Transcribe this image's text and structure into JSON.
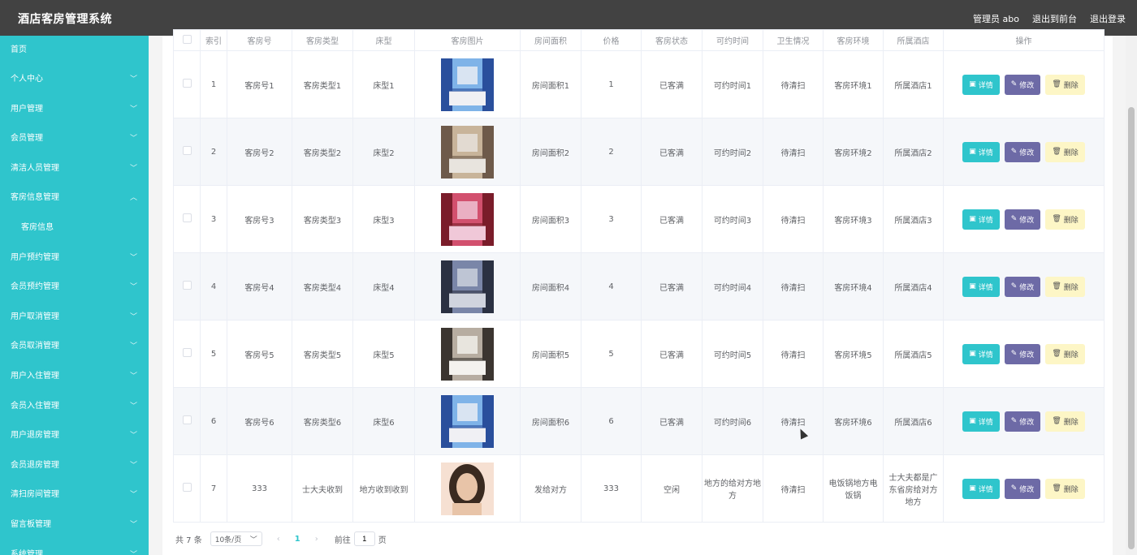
{
  "app": {
    "title": "酒店客房管理系统"
  },
  "header_links": {
    "admin": "管理员 abo",
    "front": "退出到前台",
    "logout": "退出登录"
  },
  "sidebar": {
    "items": [
      {
        "label": "首页",
        "chevron": ""
      },
      {
        "label": "个人中心",
        "chevron": "﹀"
      },
      {
        "label": "用户管理",
        "chevron": "﹀"
      },
      {
        "label": "会员管理",
        "chevron": "﹀"
      },
      {
        "label": "清洁人员管理",
        "chevron": "﹀"
      },
      {
        "label": "客房信息管理",
        "chevron": "︿"
      },
      {
        "label": "客房信息",
        "chevron": "",
        "sub": true
      },
      {
        "label": "用户预约管理",
        "chevron": "﹀"
      },
      {
        "label": "会员预约管理",
        "chevron": "﹀"
      },
      {
        "label": "用户取消管理",
        "chevron": "﹀"
      },
      {
        "label": "会员取消管理",
        "chevron": "﹀"
      },
      {
        "label": "用户入住管理",
        "chevron": "﹀"
      },
      {
        "label": "会员入住管理",
        "chevron": "﹀"
      },
      {
        "label": "用户退房管理",
        "chevron": "﹀"
      },
      {
        "label": "会员退房管理",
        "chevron": "﹀"
      },
      {
        "label": "清扫房间管理",
        "chevron": "﹀"
      },
      {
        "label": "留言板管理",
        "chevron": "﹀"
      },
      {
        "label": "系统管理",
        "chevron": "﹀"
      }
    ]
  },
  "table": {
    "headers": [
      "",
      "索引",
      "客房号",
      "客房类型",
      "床型",
      "客房图片",
      "房间面积",
      "价格",
      "客房状态",
      "可约时间",
      "卫生情况",
      "客房环境",
      "所属酒店",
      "操作"
    ],
    "rows": [
      {
        "idx": "1",
        "room": "客房号1",
        "type": "客房类型1",
        "bed": "床型1",
        "img": "blue",
        "area": "房间面积1",
        "price": "1",
        "status": "已客满",
        "time": "可约时间1",
        "clean": "待清扫",
        "env": "客房环境1",
        "hotel": "所属酒店1"
      },
      {
        "idx": "2",
        "room": "客房号2",
        "type": "客房类型2",
        "bed": "床型2",
        "img": "brown",
        "area": "房间面积2",
        "price": "2",
        "status": "已客满",
        "time": "可约时间2",
        "clean": "待清扫",
        "env": "客房环境2",
        "hotel": "所属酒店2"
      },
      {
        "idx": "3",
        "room": "客房号3",
        "type": "客房类型3",
        "bed": "床型3",
        "img": "red",
        "area": "房间面积3",
        "price": "3",
        "status": "已客满",
        "time": "可约时间3",
        "clean": "待清扫",
        "env": "客房环境3",
        "hotel": "所属酒店3"
      },
      {
        "idx": "4",
        "room": "客房号4",
        "type": "客房类型4",
        "bed": "床型4",
        "img": "slate",
        "area": "房间面积4",
        "price": "4",
        "status": "已客满",
        "time": "可约时间4",
        "clean": "待清扫",
        "env": "客房环境4",
        "hotel": "所属酒店4"
      },
      {
        "idx": "5",
        "room": "客房号5",
        "type": "客房类型5",
        "bed": "床型5",
        "img": "white",
        "area": "房间面积5",
        "price": "5",
        "status": "已客满",
        "time": "可约时间5",
        "clean": "待清扫",
        "env": "客房环境5",
        "hotel": "所属酒店5"
      },
      {
        "idx": "6",
        "room": "客房号6",
        "type": "客房类型6",
        "bed": "床型6",
        "img": "blue",
        "area": "房间面积6",
        "price": "6",
        "status": "已客满",
        "time": "可约时间6",
        "clean": "待清扫",
        "env": "客房环境6",
        "hotel": "所属酒店6"
      },
      {
        "idx": "7",
        "room": "333",
        "type": "士大夫收到",
        "bed": "地方收到收到",
        "img": "portrait",
        "area": "发给对方",
        "price": "333",
        "status": "空闲",
        "time": "地方的给对方地方",
        "clean": "待清扫",
        "env": "电饭锅地方电饭锅",
        "hotel": "士大夫都是广东省房给对方地方"
      }
    ],
    "actions": {
      "detail": "详情",
      "edit": "修改",
      "delete": "删除"
    }
  },
  "pagination": {
    "total": "共 7 条",
    "page_size": "10条/页",
    "prev": "‹",
    "current": "1",
    "next": "›",
    "goto_prefix": "前往",
    "goto_value": "1",
    "goto_suffix": "页"
  },
  "colors": {
    "accent": "#2fc5cc",
    "header": "#424242",
    "edit": "#6d6aa6",
    "delete": "#fdf6c6"
  },
  "image_palettes": {
    "blue": [
      "#2a4f9c",
      "#7fb3e8",
      "#f0f0f4"
    ],
    "brown": [
      "#6e5a4a",
      "#c8b49a",
      "#e8e4de"
    ],
    "red": [
      "#7a1c2a",
      "#d2506e",
      "#f0c8d8"
    ],
    "slate": [
      "#2b3142",
      "#7a86a8",
      "#d0d4de"
    ],
    "white": [
      "#3b3530",
      "#b7ada1",
      "#f4f2ee"
    ],
    "portrait": [
      "#3a2a20",
      "#e8c4a8",
      "#f6e0d2"
    ]
  }
}
